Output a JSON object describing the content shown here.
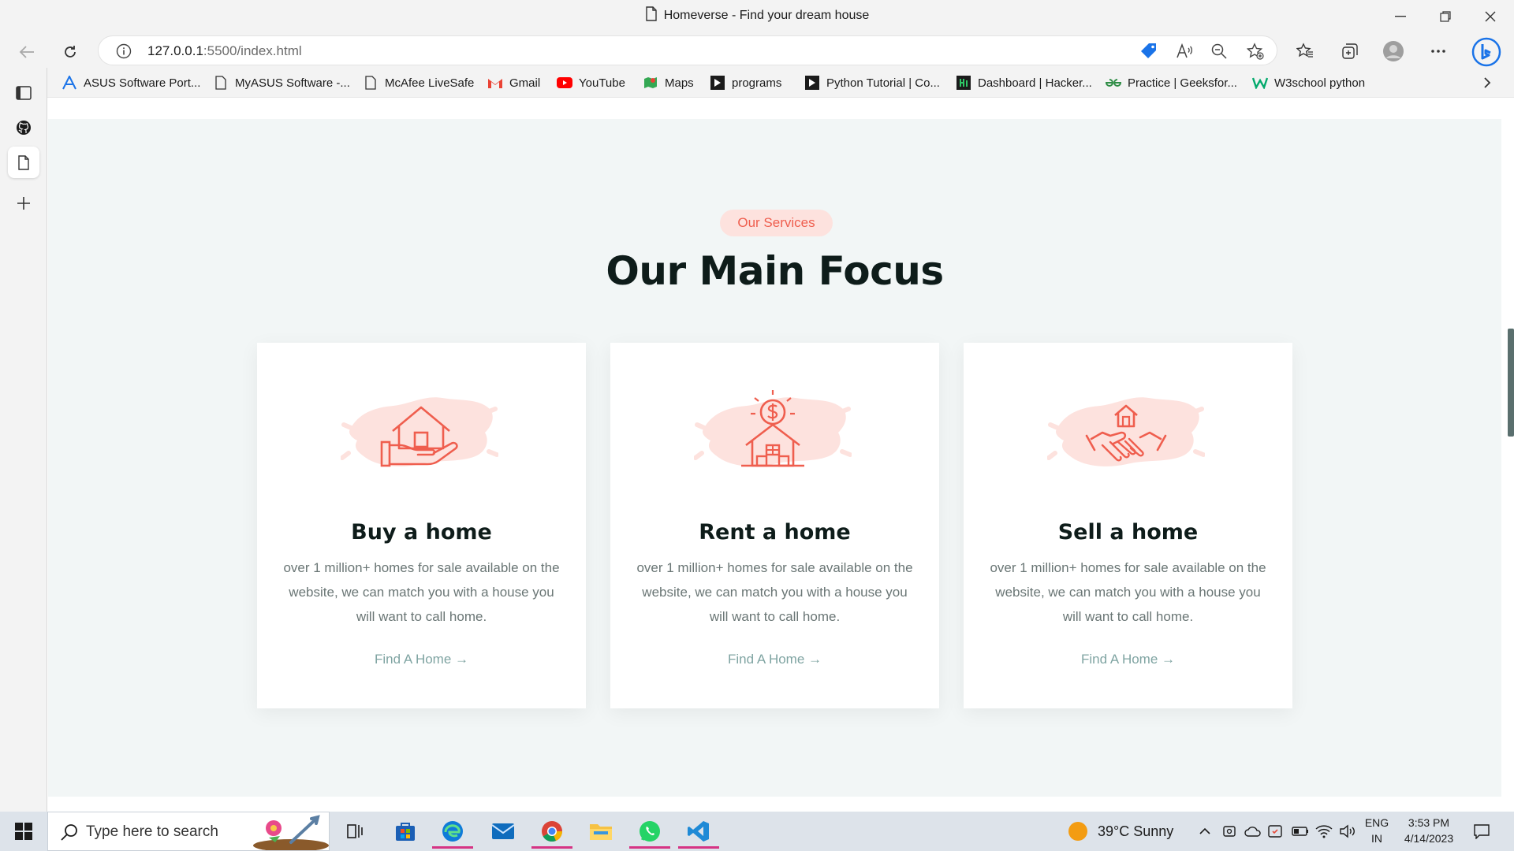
{
  "window": {
    "title": "Homeverse - Find your dream house"
  },
  "address": {
    "url_host": "127.0.0.1",
    "url_rest": ":5500/index.html"
  },
  "favorites": [
    {
      "label": "ASUS Software Port...",
      "icon": "asus-icon"
    },
    {
      "label": "MyASUS Software -...",
      "icon": "page-icon"
    },
    {
      "label": "McAfee LiveSafe",
      "icon": "page-icon"
    },
    {
      "label": "Gmail",
      "icon": "gmail-icon"
    },
    {
      "label": "YouTube",
      "icon": "youtube-icon"
    },
    {
      "label": "Maps",
      "icon": "maps-icon"
    },
    {
      "label": "programs",
      "icon": "programs-icon"
    },
    {
      "label": "Python Tutorial | Co...",
      "icon": "codechef-icon"
    },
    {
      "label": "Dashboard | Hacker...",
      "icon": "hackerrank-icon"
    },
    {
      "label": "Practice | Geeksfor...",
      "icon": "gfg-icon"
    },
    {
      "label": "W3school python",
      "icon": "w3schools-icon"
    }
  ],
  "services": {
    "badge": "Our Services",
    "heading": "Our Main Focus",
    "cards": [
      {
        "title": "Buy a home",
        "text": "over 1 million+ homes for sale available on the website, we can match you with a house you will want to call home.",
        "link": "Find A Home",
        "icon": "house-in-hand-icon"
      },
      {
        "title": "Rent a home",
        "text": "over 1 million+ homes for sale available on the website, we can match you with a house you will want to call home.",
        "link": "Find A Home",
        "icon": "house-with-dollar-icon"
      },
      {
        "title": "Sell a home",
        "text": "over 1 million+ homes for sale available on the website, we can match you with a house you will want to call home.",
        "link": "Find A Home",
        "icon": "handshake-house-icon"
      }
    ]
  },
  "taskbar": {
    "search_placeholder": "Type here to search",
    "weather": "39°C  Sunny",
    "lang_top": "ENG",
    "lang_bottom": "IN",
    "time": "3:53 PM",
    "date": "4/14/2023"
  },
  "colors": {
    "accent": "#ef5e4e",
    "badge_bg": "#fde2de",
    "section_bg": "#f2f6f6",
    "link": "#7fa4a2"
  }
}
